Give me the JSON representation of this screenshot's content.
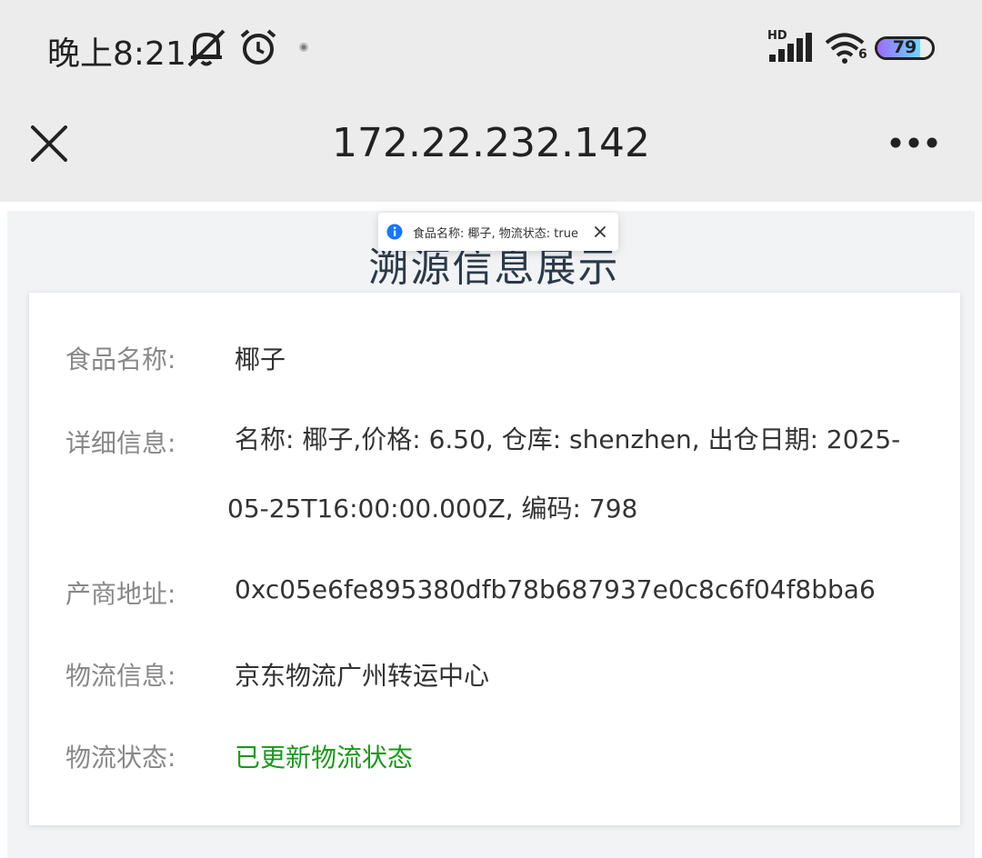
{
  "status_bar": {
    "time": "晚上8:21",
    "network_label": "HD",
    "wifi_label": "6",
    "battery": "79",
    "battery_level": 0.79
  },
  "browser": {
    "url": "172.22.232.142",
    "close_icon": "close-icon",
    "menu_icon": "more-icon"
  },
  "page": {
    "heading": "溯源信息展示",
    "rows": [
      {
        "label": "食品名称:",
        "value": "椰子"
      },
      {
        "label": "详细信息:",
        "value": "名称: 椰子,价格: 6.50, 仓库: shenzhen, 出仓日期: 2025-05-25T16:00:00.000Z, 编码: 798"
      },
      {
        "label": "产商地址:",
        "value": "0xc05e6fe895380dfb78b687937e0c8c6f04f8bba6"
      },
      {
        "label": "物流信息:",
        "value": "京东物流广州转运中心"
      },
      {
        "label": "物流状态:",
        "value": "已更新物流状态"
      }
    ],
    "status_color": "#1a9a1a"
  },
  "toast": {
    "message": "食品名称: 椰子, 物流状态: true",
    "icon": "info-icon"
  }
}
